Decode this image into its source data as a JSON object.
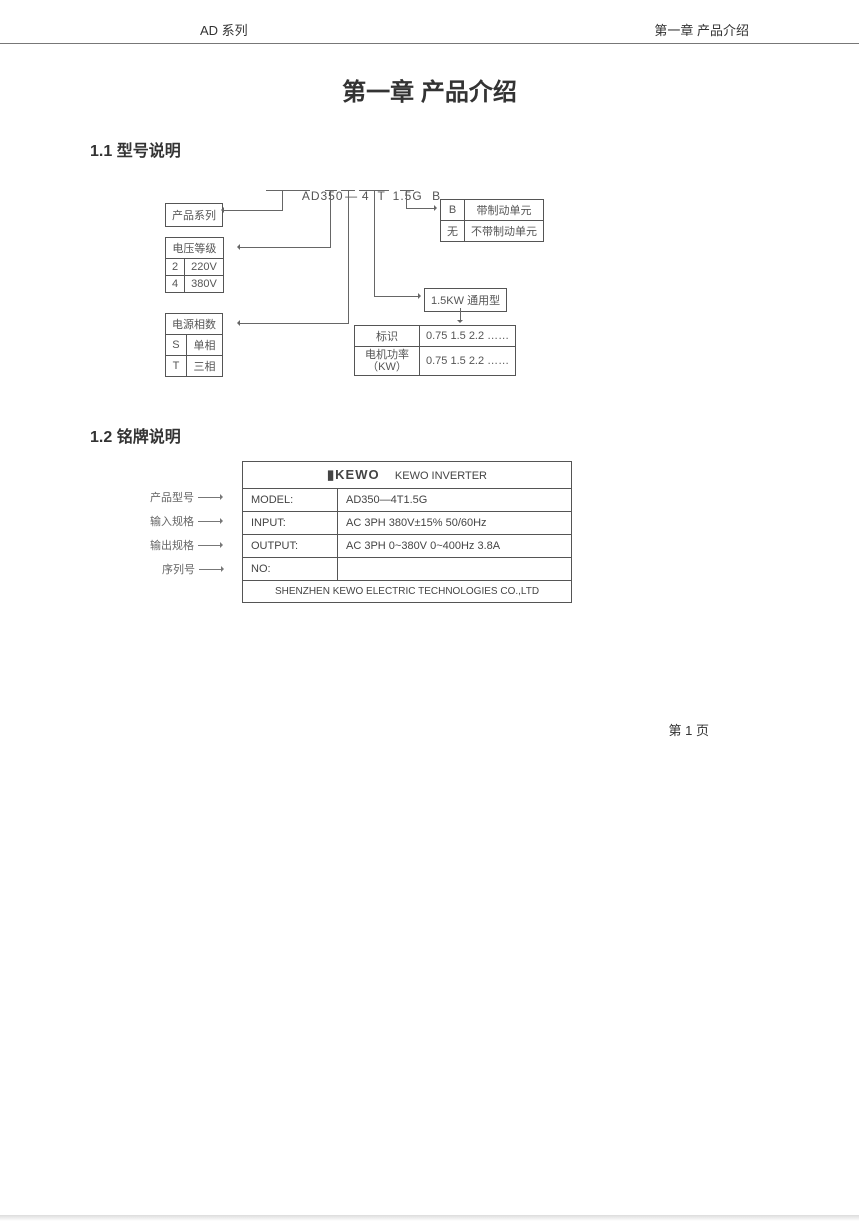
{
  "header": {
    "left": "AD 系列",
    "right": "第一章 产品介绍"
  },
  "chapter_title": "第一章 产品介绍",
  "section1": {
    "title": "1.1 型号说明"
  },
  "model_code": {
    "p1": "AD350",
    "sep1": "—",
    "p2": "4",
    "p3": "T",
    "p4": "1.5G",
    "p5": "B"
  },
  "d": {
    "series": "产品系列",
    "brake_hdr_b": "B",
    "brake_b": "带制动单元",
    "brake_hdr_n": "无",
    "brake_n": "不带制动单元",
    "volt_hdr": "电压等级",
    "volt_2": "2",
    "volt_220": "220V",
    "volt_4": "4",
    "volt_380": "380V",
    "usage": "1.5KW 通用型",
    "phase_hdr": "电源相数",
    "ph_s": "S",
    "ph_single": "单相",
    "ph_t": "T",
    "ph_three": "三相",
    "mark": "标识",
    "mark_vals": "0.75  1.5  2.2  ……",
    "mpower": "电机功率（KW）",
    "mpower_vals": "0.75  1.5  2.2  ……"
  },
  "section2": {
    "title": "1.2 铭牌说明"
  },
  "np_labels": {
    "model": "产品型号",
    "input": "输入规格",
    "output": "输出规格",
    "serial": "序列号"
  },
  "nameplate": {
    "brand": "KEWO",
    "brand_sub": "KEWO  INVERTER",
    "model_l": "MODEL:",
    "model_v": "AD350—4T1.5G",
    "input_l": "INPUT:",
    "input_v": "AC 3PH  380V±15%  50/60Hz",
    "output_l": "OUTPUT:",
    "output_v": "AC 3PH  0~380V  0~400Hz  3.8A",
    "no_l": "NO:",
    "no_v": "",
    "company": "SHENZHEN KEWO ELECTRIC TECHNOLOGIES CO.,LTD"
  },
  "footer": {
    "page": "第  1  页"
  }
}
